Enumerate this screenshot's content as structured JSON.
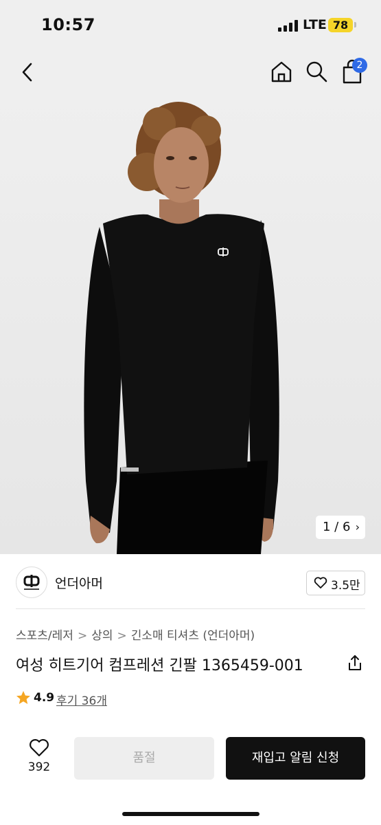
{
  "status_bar": {
    "time": "10:57",
    "network": "LTE",
    "battery": "78"
  },
  "header": {
    "cart_count": "2"
  },
  "gallery": {
    "pager": "1 / 6",
    "pager_arrow": "›",
    "brand_color": "#111111"
  },
  "brand": {
    "name": "언더아머",
    "like_count": "3.5만"
  },
  "breadcrumb": {
    "items": [
      "스포츠/레저",
      "상의",
      "긴소매 티셔츠 (언더아머)"
    ],
    "separator": ">"
  },
  "product": {
    "title": "여성 히트기어 컴프레션 긴팔 1365459-001",
    "rating": "4.9",
    "review_link": "후기 36개"
  },
  "bottom_bar": {
    "wish_count": "392",
    "soldout_label": "품절",
    "restock_label": "재입고 알림 신청"
  },
  "colors": {
    "accent": "#2f6ae6",
    "star": "#f5a623",
    "battery": "#f5d429"
  },
  "icons": [
    "back-arrow-icon",
    "home-icon",
    "search-icon",
    "bag-icon",
    "heart-icon",
    "share-icon",
    "star-icon"
  ]
}
